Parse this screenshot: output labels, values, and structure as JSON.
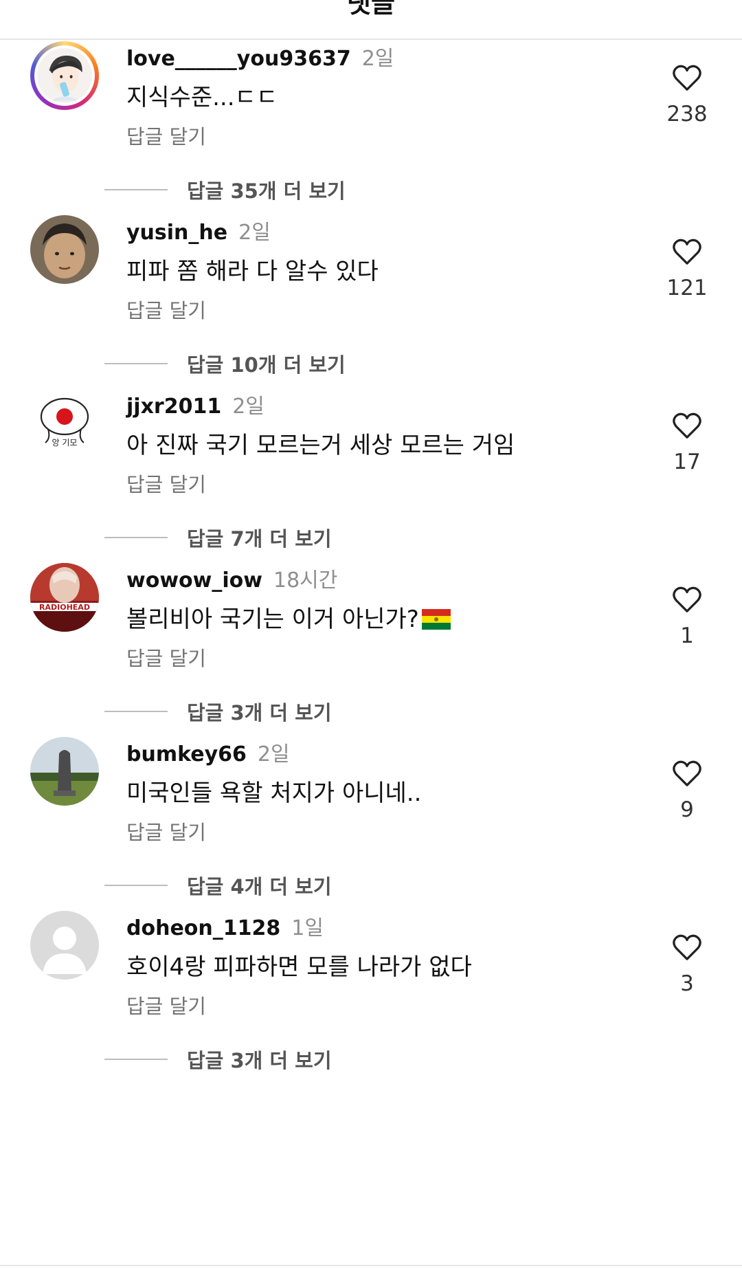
{
  "header": {
    "title": "댓글"
  },
  "comments": [
    {
      "username": "love______you93637",
      "time": "2일",
      "text": "지식수준...ㄷㄷ",
      "reply_label": "답글 달기",
      "view_replies": "답글 35개 더 보기",
      "likes": "238",
      "avatar_icon": "illustrated-face-avatar"
    },
    {
      "username": "yusin_he",
      "time": "2일",
      "text": "피파 쫌 해라 다 알수 있다",
      "reply_label": "답글 달기",
      "view_replies": "답글 10개 더 보기",
      "likes": "121",
      "avatar_icon": "photo-face-avatar"
    },
    {
      "username": "jjxr2011",
      "time": "2일",
      "text": "아 진짜 국기 모르는거 세상 모르는 거임",
      "reply_label": "답글 달기",
      "view_replies": "답글 7개 더 보기",
      "likes": "17",
      "avatar_icon": "cartoon-flag-face-avatar",
      "avatar_caption": "앙 기모"
    },
    {
      "username": "wowow_iow",
      "time": "18시간",
      "text": "볼리비아 국기는 이거 아닌가?",
      "flag_icon": "bolivia-flag-emoji",
      "reply_label": "답글 달기",
      "view_replies": "답글 3개 더 보기",
      "likes": "1",
      "avatar_icon": "album-cover-avatar",
      "avatar_caption": "RADIOHEAD"
    },
    {
      "username": "bumkey66",
      "time": "2일",
      "text": "미국인들 욕할 처지가 아니네..",
      "reply_label": "답글 달기",
      "view_replies": "답글 4개 더 보기",
      "likes": "9",
      "avatar_icon": "stone-monument-avatar"
    },
    {
      "username": "doheon_1128",
      "time": "1일",
      "text": "호이4랑 피파하면 모를 나라가 없다",
      "reply_label": "답글 달기",
      "view_replies": "답글 3개 더 보기",
      "likes": "3",
      "avatar_icon": "default-person-avatar"
    }
  ],
  "colors": {
    "muted_text": "#737373",
    "time_text": "#8e8e8e",
    "divider": "#e6e6e6"
  }
}
